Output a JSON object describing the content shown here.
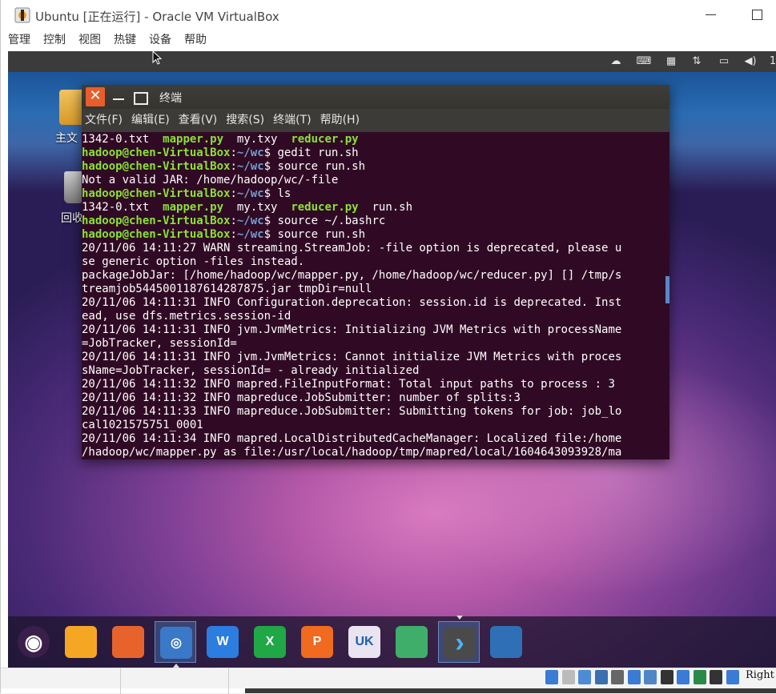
{
  "window": {
    "title": "Ubuntu [正在运行] - Oracle VM VirtualBox"
  },
  "vbox_menu": [
    "管理",
    "控制",
    "视图",
    "热键",
    "设备",
    "帮助"
  ],
  "guest_topbar": {
    "tray_icons": [
      "weather-icon",
      "keyboard-icon",
      "keyboard-layout-icon",
      "network-icon",
      "battery-icon",
      "volume-icon"
    ],
    "clock_fragment": "1"
  },
  "desktop": {
    "icons": [
      {
        "label": "主文",
        "icon": "home-folder-icon"
      },
      {
        "label": "回收",
        "icon": "trash-icon"
      }
    ]
  },
  "terminal": {
    "title": "终端",
    "menu": [
      "文件(F)",
      "编辑(E)",
      "查看(V)",
      "搜索(S)",
      "终端(T)",
      "帮助(H)"
    ],
    "prompt_user": "hadoop@chen-VirtualBox",
    "prompt_path": "~/wc",
    "lines": [
      {
        "type": "ls",
        "items": [
          [
            "1342-0.txt",
            false
          ],
          [
            "mapper.py",
            true
          ],
          [
            "my.txy",
            false
          ],
          [
            "reducer.py",
            true
          ]
        ]
      },
      {
        "type": "cmd",
        "cmd": "gedit run.sh"
      },
      {
        "type": "cmd",
        "cmd": "source run.sh"
      },
      {
        "type": "text",
        "text": "Not a valid JAR: /home/hadoop/wc/-file"
      },
      {
        "type": "cmd",
        "cmd": "ls"
      },
      {
        "type": "ls",
        "items": [
          [
            "1342-0.txt",
            false
          ],
          [
            "mapper.py",
            true
          ],
          [
            "my.txy",
            false
          ],
          [
            "reducer.py",
            true
          ],
          [
            "run.sh",
            false
          ]
        ]
      },
      {
        "type": "cmd",
        "cmd": "source ~/.bashrc"
      },
      {
        "type": "cmd",
        "cmd": "source run.sh"
      },
      {
        "type": "text",
        "text": "20/11/06 14:11:27 WARN streaming.StreamJob: -file option is deprecated, please u"
      },
      {
        "type": "text",
        "text": "se generic option -files instead."
      },
      {
        "type": "text",
        "text": "packageJobJar: [/home/hadoop/wc/mapper.py, /home/hadoop/wc/reducer.py] [] /tmp/s"
      },
      {
        "type": "text",
        "text": "treamjob5445001187614287875.jar tmpDir=null"
      },
      {
        "type": "text",
        "text": "20/11/06 14:11:31 INFO Configuration.deprecation: session.id is deprecated. Inst"
      },
      {
        "type": "text",
        "text": "ead, use dfs.metrics.session-id"
      },
      {
        "type": "text",
        "text": "20/11/06 14:11:31 INFO jvm.JvmMetrics: Initializing JVM Metrics with processName"
      },
      {
        "type": "text",
        "text": "=JobTracker, sessionId="
      },
      {
        "type": "text",
        "text": "20/11/06 14:11:31 INFO jvm.JvmMetrics: Cannot initialize JVM Metrics with proces"
      },
      {
        "type": "text",
        "text": "sName=JobTracker, sessionId= - already initialized"
      },
      {
        "type": "text",
        "text": "20/11/06 14:11:32 INFO mapred.FileInputFormat: Total input paths to process : 3"
      },
      {
        "type": "text",
        "text": "20/11/06 14:11:32 INFO mapreduce.JobSubmitter: number of splits:3"
      },
      {
        "type": "text",
        "text": "20/11/06 14:11:33 INFO mapreduce.JobSubmitter: Submitting tokens for job: job_lo"
      },
      {
        "type": "text",
        "text": "cal1021575751_0001"
      },
      {
        "type": "text",
        "text": "20/11/06 14:11:34 INFO mapred.LocalDistributedCacheManager: Localized file:/home"
      },
      {
        "type": "text",
        "text": "/hadoop/wc/mapper.py as file:/usr/local/hadoop/tmp/mapred/local/1604643093928/ma"
      }
    ]
  },
  "dock": [
    {
      "name": "ubuntu-logo-icon",
      "glyph": "◉",
      "color": "#3a1f4a"
    },
    {
      "name": "files-icon",
      "glyph": "",
      "color": "#f5a623"
    },
    {
      "name": "firefox-icon",
      "glyph": "",
      "color": "#e8632b"
    },
    {
      "name": "chromium-icon",
      "glyph": "◎",
      "color": "#3a78c8"
    },
    {
      "name": "wps-writer-icon",
      "glyph": "W",
      "color": "#2b7de0"
    },
    {
      "name": "wps-spreadsheet-icon",
      "glyph": "X",
      "color": "#1fa845"
    },
    {
      "name": "wps-presentation-icon",
      "glyph": "P",
      "color": "#f06a1f"
    },
    {
      "name": "ubuntu-software-icon",
      "glyph": "UK",
      "color": "#e9e4ef"
    },
    {
      "name": "updater-icon",
      "glyph": "",
      "color": "#3fae6a"
    },
    {
      "name": "terminal-launcher-icon",
      "glyph": "›",
      "color": "#4a4a4a"
    },
    {
      "name": "workspace-switcher-icon",
      "glyph": "",
      "color": "#2f6fb5"
    }
  ],
  "statusbar": {
    "host_key": "Right"
  }
}
